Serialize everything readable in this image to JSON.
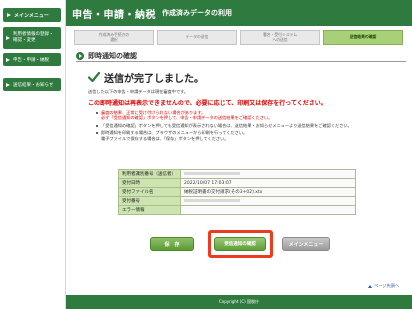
{
  "sidebar": {
    "items": [
      {
        "label": "メインメニュー"
      },
      {
        "label_line1": "利用者情報の登録・",
        "label_line2": "確認・変更"
      },
      {
        "label": "申告・申請・納税"
      },
      {
        "label": "送信結果・お知らせ"
      }
    ]
  },
  "header": {
    "title": "申告・申請・納税",
    "subtitle": "作成済みデータの利用"
  },
  "steps": [
    {
      "line1": "作成済み手続きの",
      "line2": "選択"
    },
    {
      "line1": "データの送信",
      "line2": ""
    },
    {
      "line1": "署名・受付システム",
      "line2": "への送信"
    },
    {
      "line1": "送信結果の確認",
      "line2": ""
    }
  ],
  "section": {
    "title": "即時通知の確認"
  },
  "completion": {
    "message": "送信が完了しました。"
  },
  "notes": {
    "intro": "送信した以下の申告・申請データは現在審査中です。",
    "warning": "この即時通知は再表示できませんので、必要に応じて、印刷又は保存を行ってください。"
  },
  "bullets": [
    {
      "text1": "審査の結果、正常に受け付けられない場合があります。",
      "text2": "必ず「受信通知の確認」ボタンを押して、申告・申請データの送信結果をご確認ください。"
    },
    {
      "text1": "「受信通知の確認」ボタンを押しても受信通知が表示されない場合は、送信結果・お知らせメニューより送信結果をご確認ください。",
      "text2": ""
    },
    {
      "text1": "即時通知を印刷する場合は、ブラウザのメニューから印刷を行ってください。",
      "text2": "電子ファイルで保存する場合は、「保存」ボタンを押してください。"
    }
  ],
  "table": {
    "rows": [
      {
        "key": "利用者識別番号（送信者）",
        "value": ""
      },
      {
        "key": "受付日時",
        "value": "2022/10/07 17:03:07"
      },
      {
        "key": "受付ファイル名",
        "value": "納税証明書の交付請求(その3+02).xtx"
      },
      {
        "key": "受付番号",
        "value": ""
      },
      {
        "key": "エラー情報",
        "value": ""
      }
    ]
  },
  "buttons": {
    "save": "保　存",
    "receipt": "受信通知の確認",
    "menu": "メインメニュー"
  },
  "footer": {
    "copyright": "Copyright (C) 国税庁"
  },
  "page_top": {
    "label": "ページ先頭へ"
  },
  "colors": {
    "brand_green": "#2f7a3f",
    "warning_red": "#e00000",
    "highlight": "#ec3b1f"
  }
}
